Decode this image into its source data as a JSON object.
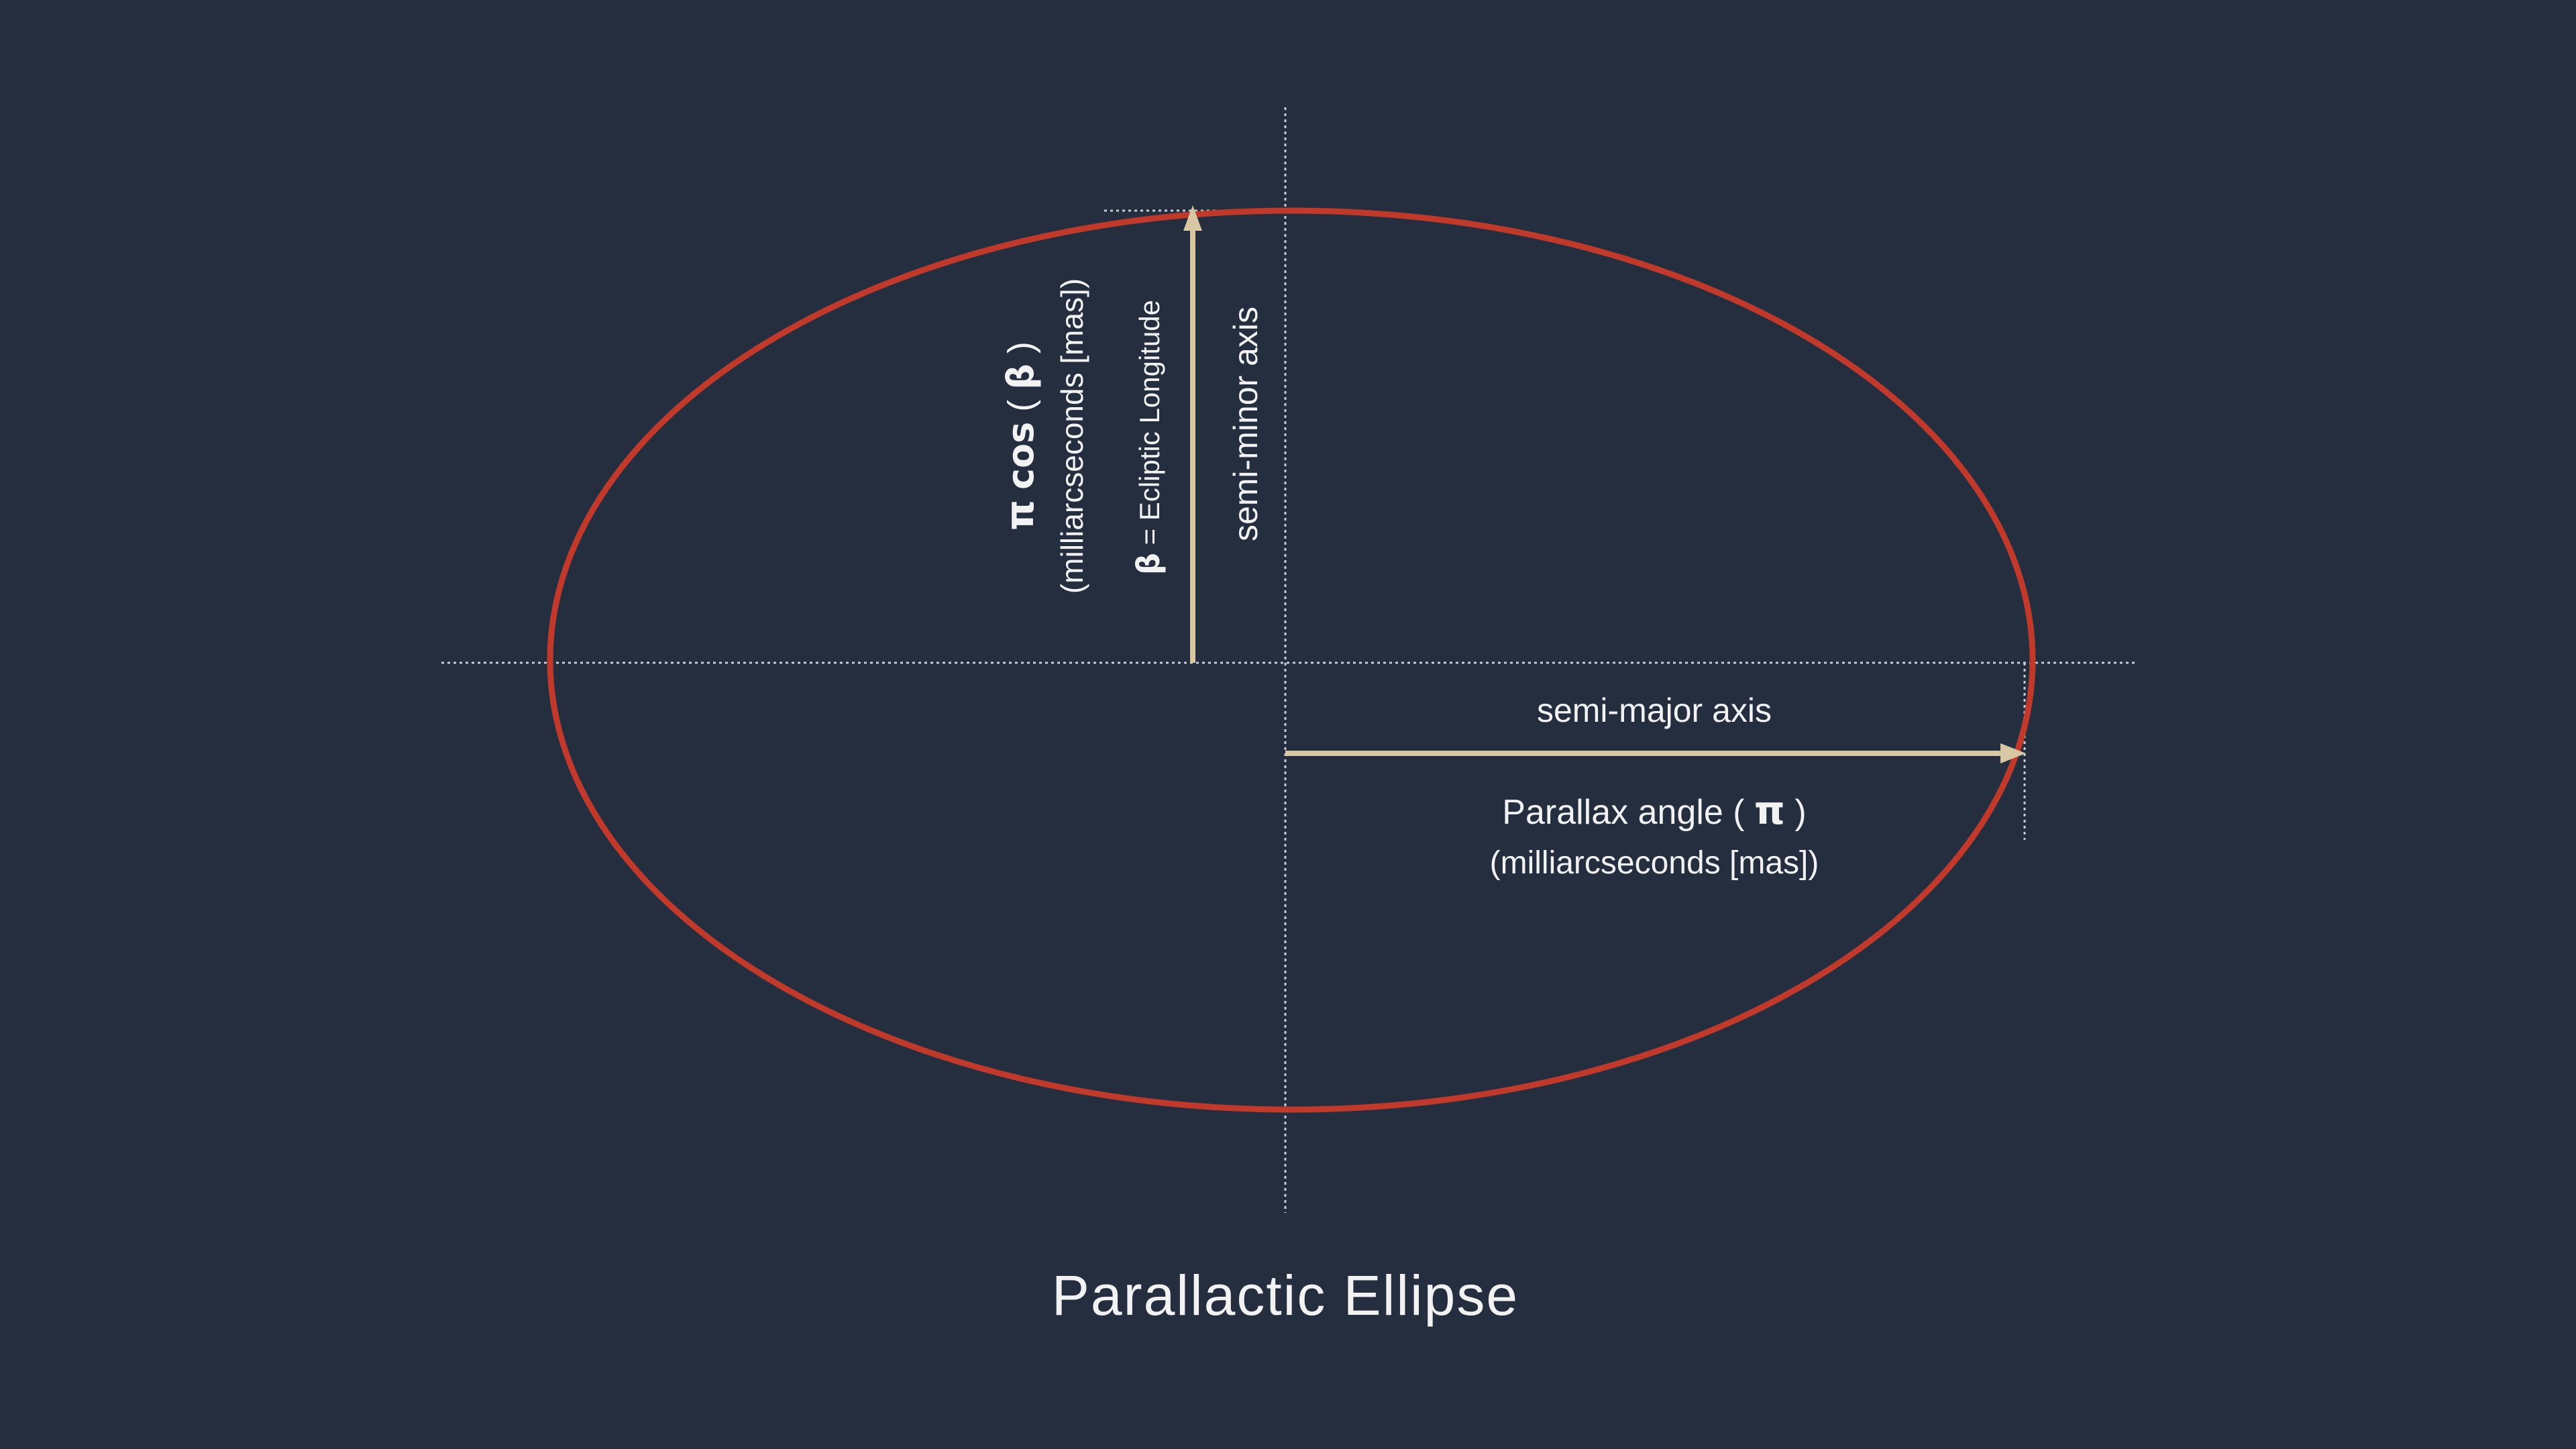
{
  "title": "Parallactic Ellipse",
  "semi_major": {
    "axis_label": "semi-major axis",
    "quantity_prefix": "Parallax angle ( ",
    "quantity_symbol": "π",
    "quantity_suffix": " )",
    "units": "(milliarcseconds [mas])"
  },
  "semi_minor": {
    "axis_label": "semi-minor axis",
    "quantity_symbol": "π",
    "quantity_cos": "cos",
    "quantity_open": " ( ",
    "quantity_beta": "β",
    "quantity_close": " )",
    "units": "(milliarcseconds [mas])",
    "beta_symbol": "β",
    "beta_definition": " = Ecliptic Longitude"
  },
  "colors": {
    "background": "#242e3f",
    "ellipse": "#c0392b",
    "arrow": "#d8c7a3",
    "guides": "#c8ccd4",
    "text": "#f2f2f2"
  }
}
